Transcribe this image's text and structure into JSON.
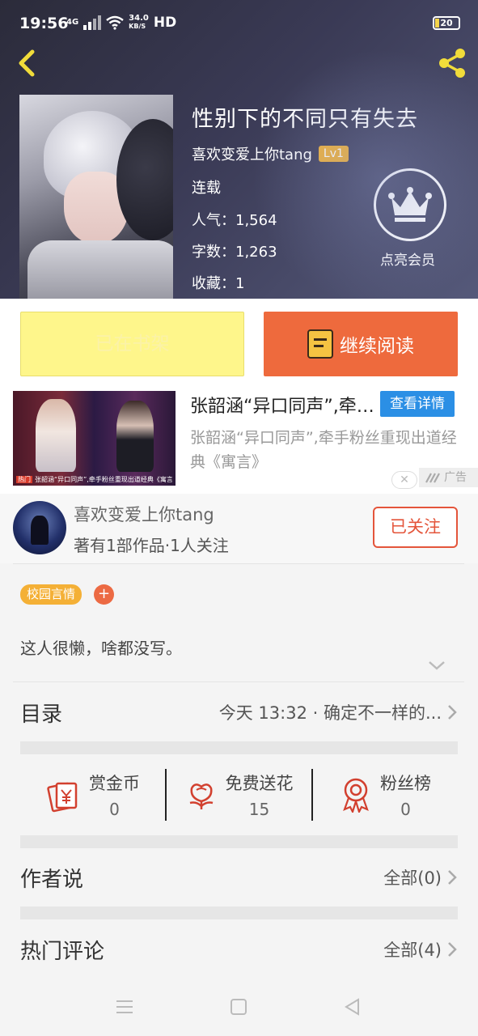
{
  "status_bar": {
    "time": "19:56",
    "net_type": "4G",
    "speed_value": "34.0",
    "speed_unit": "KB/S",
    "hd": "HD",
    "battery": "20"
  },
  "book": {
    "title": "性别下的不同只有失去",
    "author": "喜欢变爱上你tang",
    "level": "Lv1",
    "status": "连载",
    "popularity": "人气：1,564",
    "word_count": "字数：1,263",
    "favorites": "收藏：1"
  },
  "vip": {
    "label": "点亮会员"
  },
  "actions": {
    "shelf_label": "已在书架",
    "read_label": "继续阅读"
  },
  "ad": {
    "title": "张韶涵“异口同声”,牵手粉丝重现出道经典《寓言》",
    "detail_label": "查看详情",
    "desc": "张韶涵“异口同声”,牵手粉丝重现出道经典《寓言》",
    "image_tag": "热门",
    "image_caption": "张韶涵“异口同声”,牵手粉丝重现出道经典《寓言》",
    "mark": "广告",
    "close": "✕"
  },
  "author_card": {
    "name": "喜欢变爱上你tang",
    "sub": "著有1部作品·1人关注",
    "follow_label": "已关注"
  },
  "tags": {
    "genre": "校园言情",
    "add": "+"
  },
  "intro": "这人很懒，啥都没写。",
  "catalog": {
    "title": "目录",
    "latest": "今天 13:32 · 确定不一样的..."
  },
  "stats": [
    {
      "label": "赏金币",
      "value": "0",
      "icon": "red-envelope-icon"
    },
    {
      "label": "免费送花",
      "value": "15",
      "icon": "flower-icon"
    },
    {
      "label": "粉丝榜",
      "value": "0",
      "icon": "medal-icon"
    }
  ],
  "author_says": {
    "title": "作者说",
    "all": "全部(0)"
  },
  "hot_comments": {
    "title": "热门评论",
    "all": "全部(4)"
  },
  "colors": {
    "accent_orange": "#ee6a3d",
    "shelf_yellow": "#fef68b",
    "follow_red": "#e4553b",
    "tag_yellow": "#f4b036",
    "ad_blue": "#2b8fe5",
    "icon_red": "#d2402f"
  }
}
